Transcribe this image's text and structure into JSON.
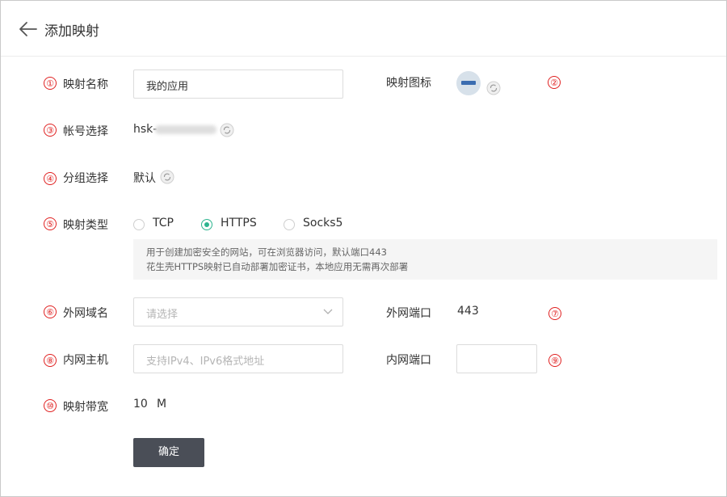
{
  "header": {
    "title": "添加映射"
  },
  "markers": [
    "①",
    "②",
    "③",
    "④",
    "⑤",
    "⑥",
    "⑦",
    "⑧",
    "⑨",
    "⑩"
  ],
  "form": {
    "map_name": {
      "label": "映射名称",
      "value": "我的应用"
    },
    "map_icon": {
      "label": "映射图标"
    },
    "account": {
      "label": "帐号选择",
      "value": "hsk-"
    },
    "group": {
      "label": "分组选择",
      "value": "默认"
    },
    "map_type": {
      "label": "映射类型",
      "options": [
        "TCP",
        "HTTPS",
        "Socks5"
      ],
      "selected": "HTTPS",
      "hint": [
        "用于创建加密安全的网站，可在浏览器访问，默认端口443",
        "花生壳HTTPS映射已自动部署加密证书，本地应用无需再次部署"
      ]
    },
    "domain": {
      "label": "外网域名",
      "placeholder": "请选择"
    },
    "ext_port": {
      "label": "外网端口",
      "value": "443"
    },
    "host": {
      "label": "内网主机",
      "placeholder": "支持IPv4、IPv6格式地址"
    },
    "int_port": {
      "label": "内网端口",
      "value": ""
    },
    "bandwidth": {
      "label": "映射带宽",
      "value": "10",
      "unit": "M"
    },
    "submit": "确定"
  },
  "colors": {
    "accent": "#2db48f",
    "marker": "#e02020",
    "button": "#4a4e57"
  },
  "icons": [
    "back-arrow-icon",
    "refresh-icon",
    "app-logo-icon",
    "chevron-down-icon"
  ]
}
